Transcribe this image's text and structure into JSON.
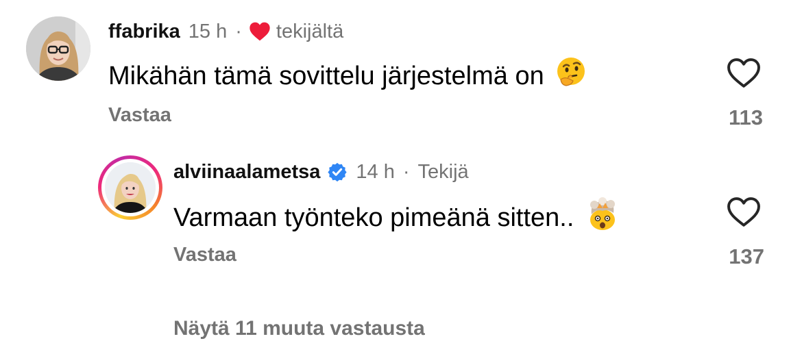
{
  "comments": [
    {
      "username": "ffabrika",
      "time": "15 h",
      "separator": "·",
      "liked_by_author_label": "tekijältä",
      "text": "Mikähän tämä sovittelu järjestelmä on",
      "emoji": "thinking-face",
      "reply_label": "Vastaa",
      "like_count": "113"
    },
    {
      "username": "alviinaalametsa",
      "verified": true,
      "time": "14 h",
      "separator": "·",
      "author_label": "Tekijä",
      "text": "Varmaan työnteko pimeänä sitten..",
      "emoji": "exploding-head",
      "reply_label": "Vastaa",
      "like_count": "137"
    }
  ],
  "more_replies_label": "Näytä 11 muuta vastausta",
  "colors": {
    "heart_red": "#ed1c3a",
    "verified_blue": "#2f86f5",
    "muted": "#737373"
  }
}
